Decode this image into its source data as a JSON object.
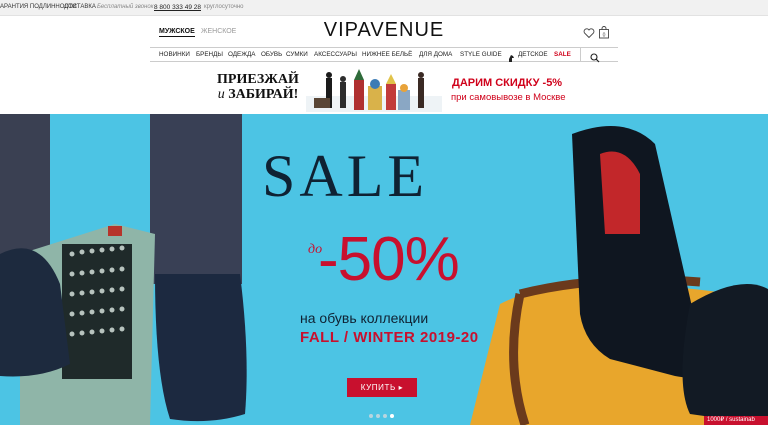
{
  "topbar": {
    "guarantee": "АРАНТИЯ ПОДЛИННОСТИ",
    "delivery": "ДОСТАВКА",
    "free_call": "Бесплатный звонок",
    "phone": "8 800 333 49 28",
    "hours": "круглосуточно"
  },
  "header": {
    "logo": "VIPAVENUE",
    "men": "МУЖСКОЕ",
    "women": "ЖЕНСКОЕ",
    "icons": [
      "heart-icon",
      "bag-icon"
    ],
    "cart_count": "0"
  },
  "nav": {
    "items": [
      "НОВИНКИ",
      "БРЕНДЫ",
      "ОДЕЖДА",
      "ОБУВЬ",
      "СУМКИ",
      "АКСЕССУАРЫ",
      "НИЖНЕЕ БЕЛЬЁ",
      "ДЛЯ ДОМА",
      "STYLE GUIDE",
      "ДЕТСКОЕ",
      "SALE"
    ],
    "search_icon": "search-icon",
    "kids_icon": "horse-icon"
  },
  "promo": {
    "line1": "ПРИЕЗЖАЙ",
    "line2_it": "и",
    "line2": "ЗАБИРАЙ!",
    "offer": "ДАРИМ СКИДКУ -5%",
    "offer_sub": "при самовывозе в Москве"
  },
  "hero": {
    "title": "SALE",
    "do": "до",
    "percent": "-50%",
    "subtitle": "на обувь коллекции",
    "collection": "FALL / WINTER 2019-20",
    "button": "КУПИТЬ",
    "corner": "1000₽ / sustainab"
  },
  "colors": {
    "accent_red": "#c8102e",
    "hero_bg": "#4cc4e4",
    "navy": "#0f2233"
  }
}
